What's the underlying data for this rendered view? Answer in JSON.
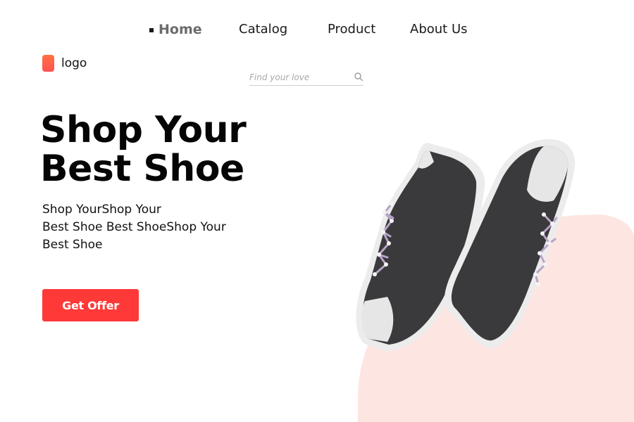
{
  "nav": {
    "items": [
      {
        "label": "Home",
        "active": true
      },
      {
        "label": "Catalog",
        "active": false
      },
      {
        "label": "Product",
        "active": false
      },
      {
        "label": "About Us",
        "active": false
      }
    ]
  },
  "logo": {
    "text": "logo"
  },
  "search": {
    "placeholder": "Find your love",
    "value": "",
    "icon": "search-icon"
  },
  "hero": {
    "title_line1": "Shop Your",
    "title_line2": "Best Shoe",
    "description_lines": [
      "Shop YourShop Your",
      "Best Shoe Best ShoeShop Your",
      "Best Shoe"
    ],
    "cta_label": "Get Offer"
  },
  "colors": {
    "accent": "#ff3838",
    "logo_gradient_top": "#ff7043",
    "logo_gradient_bottom": "#ff5252",
    "blob": "#fde5e2",
    "shoe_upper": "#3a3a3c",
    "shoe_sole": "#ececec",
    "laces": "#b9a5c9"
  }
}
